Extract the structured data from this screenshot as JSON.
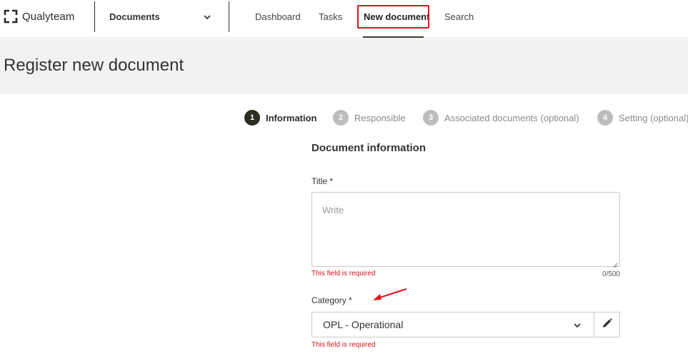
{
  "brand": {
    "name": "Qualyteam",
    "logo_icon": "bracket-square-logo"
  },
  "module_selector": {
    "label": "Documents",
    "icon": "chevron-down-icon"
  },
  "nav": {
    "items": [
      {
        "label": "Dashboard",
        "active": false
      },
      {
        "label": "Tasks",
        "active": false
      },
      {
        "label": "New document",
        "active": true
      },
      {
        "label": "Search",
        "active": false
      }
    ]
  },
  "page": {
    "title": "Register new document"
  },
  "stepper": {
    "steps": [
      {
        "number": "1",
        "label": "Information",
        "current": true
      },
      {
        "number": "2",
        "label": "Responsible",
        "current": false
      },
      {
        "number": "3",
        "label": "Associated documents (optional)",
        "current": false
      },
      {
        "number": "4",
        "label": "Setting (optional)",
        "current": false
      }
    ]
  },
  "form": {
    "section_title": "Document information",
    "title_field": {
      "label": "Title *",
      "value": "",
      "placeholder": "Write",
      "error": "This field is required",
      "counter": "0/500"
    },
    "category_field": {
      "label": "Category *",
      "value": "OPL - Operational",
      "error": "This field is required",
      "edit_icon": "pencil-icon"
    }
  },
  "colors": {
    "highlight": "#e3121d",
    "error": "#d9131c",
    "step_current": "#2c2c22",
    "step_inactive": "#bdbdbd",
    "header_band": "#f2f2f2"
  }
}
